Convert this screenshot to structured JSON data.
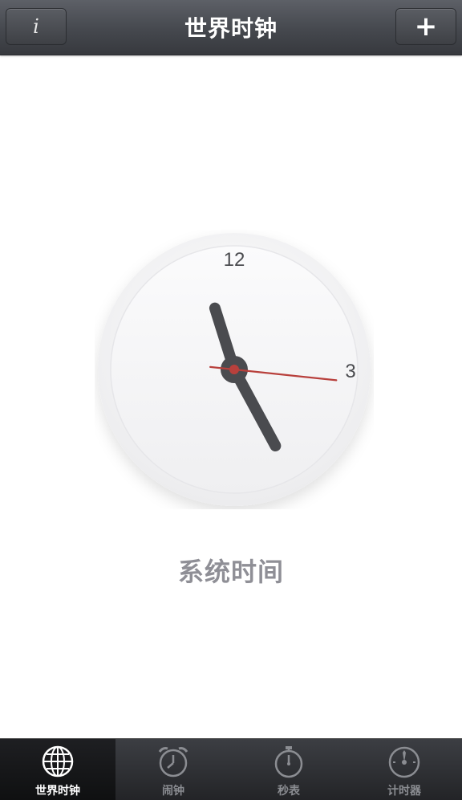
{
  "navbar": {
    "title": "世界时钟",
    "info_label": "i",
    "add_label": "+"
  },
  "clock": {
    "label_12": "12",
    "label_3": "3",
    "caption": "系统时间",
    "time": {
      "hour": 11,
      "minute": 25,
      "second": 16
    },
    "colors": {
      "hand": "#4a4b4f",
      "second_hand": "#b8403c",
      "face": "#f4f4f5"
    }
  },
  "tabbar": {
    "tabs": [
      {
        "label": "世界时钟",
        "icon": "globe-icon",
        "active": true
      },
      {
        "label": "闹钟",
        "icon": "alarm-clock-icon",
        "active": false
      },
      {
        "label": "秒表",
        "icon": "stopwatch-icon",
        "active": false
      },
      {
        "label": "计时器",
        "icon": "timer-icon",
        "active": false
      }
    ]
  }
}
